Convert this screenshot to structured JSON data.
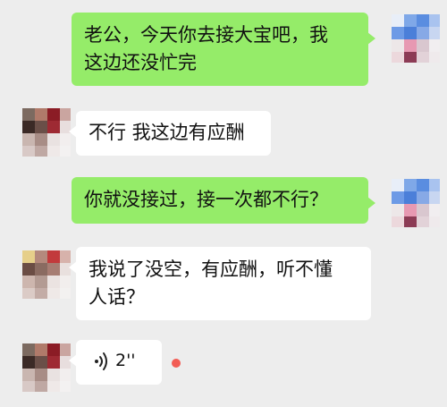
{
  "messages": [
    {
      "side": "right",
      "text": "老公，今天你去接大宝吧，我\n这边还没忙完"
    },
    {
      "side": "left",
      "text": "不行 我这边有应酬"
    },
    {
      "side": "right",
      "text": "你就没接过，接一次都不行？"
    },
    {
      "side": "left",
      "text": "我说了没空，有应酬，听不懂\n人话？"
    },
    {
      "side": "left",
      "type": "voice",
      "duration": "2''",
      "unread": true
    }
  ],
  "colors": {
    "background": "#ededed",
    "sent_bubble": "#95ec69",
    "received_bubble": "#ffffff",
    "unread_dot": "#f25c54"
  },
  "icons": {
    "voice": "voice-wave-icon"
  }
}
